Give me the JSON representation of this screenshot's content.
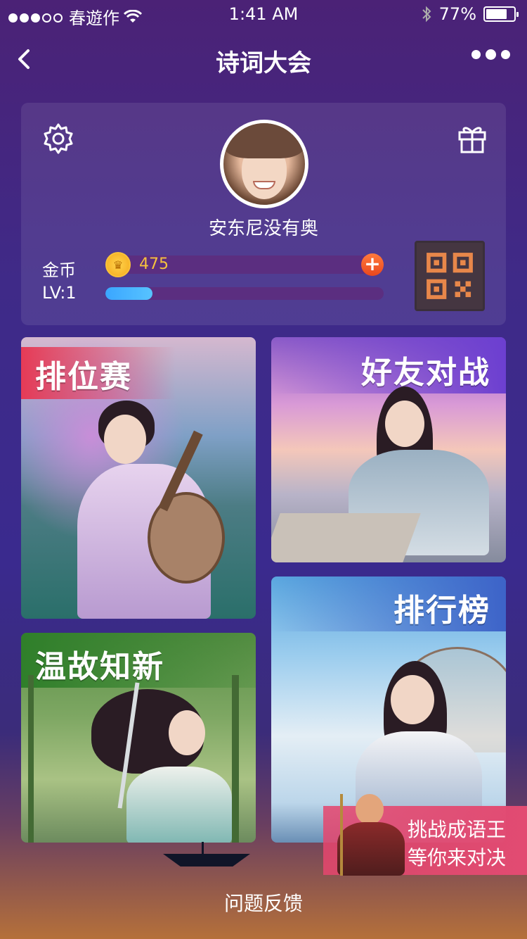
{
  "status_bar": {
    "carrier": "春遊作",
    "time": "1:41 AM",
    "battery": "77%",
    "battery_level": 0.77
  },
  "nav": {
    "title": "诗词大会"
  },
  "profile": {
    "username": "安东尼没有奥",
    "coin_label": "金币",
    "coin_value": "475",
    "level_label": "LV:1",
    "level_progress": 0.17
  },
  "tiles": [
    {
      "label": "排位赛"
    },
    {
      "label": "好友对战"
    },
    {
      "label": "温故知新"
    },
    {
      "label": "排行榜"
    }
  ],
  "promo": {
    "line1": "挑战成语王",
    "line2": "等你来对决"
  },
  "footer": {
    "feedback_label": "问题反馈"
  },
  "colors": {
    "accent_blue": "#3aa6ff",
    "coin_gold": "#f6c23d",
    "qr_orange": "#e8874a",
    "promo_pink": "#e24b72"
  }
}
